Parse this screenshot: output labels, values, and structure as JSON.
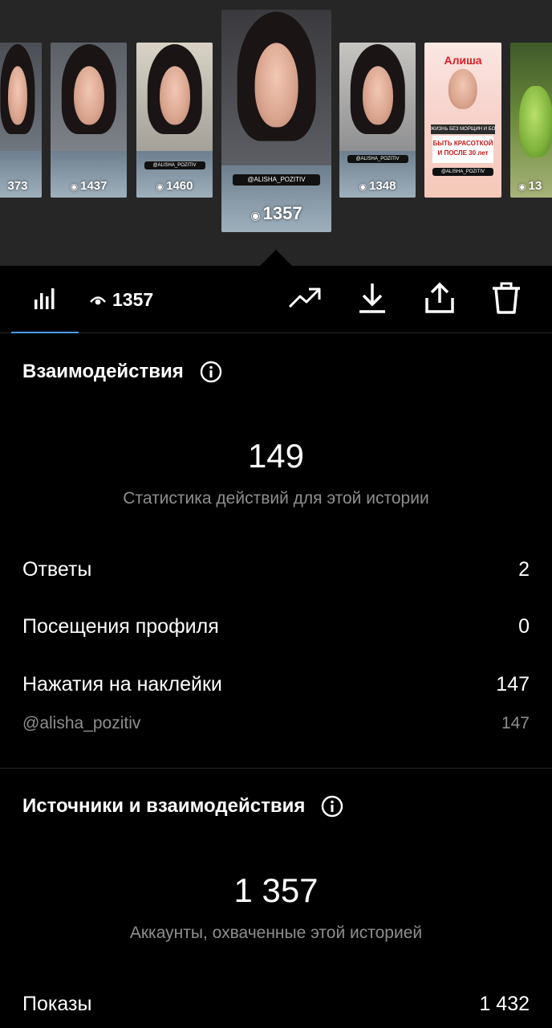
{
  "carousel": {
    "thumbs": [
      {
        "count": "373",
        "tag": "",
        "kind": "photo"
      },
      {
        "count": "1437",
        "tag": "",
        "kind": "photo"
      },
      {
        "count": "1460",
        "tag": "@ALISHA_POZITIV",
        "kind": "photo"
      },
      {
        "count": "1357",
        "tag": "@ALISHA_POZITIV",
        "kind": "photo",
        "selected": true
      },
      {
        "count": "1348",
        "tag": "@ALISHA_POZITIV",
        "kind": "photo"
      },
      {
        "count": "",
        "tag": "@ALISHA_POZITIV",
        "kind": "promo",
        "promo_title": "Алиша",
        "promo_strip": "ЖИЗНЬ БЕЗ МОРЩИН И БОТОКСА",
        "promo_box": "БЫТЬ КРАСОТКОЙ И ПОСЛЕ 30 лет"
      },
      {
        "count": "13",
        "tag": "",
        "kind": "dragon"
      }
    ]
  },
  "toolbar": {
    "views_count": "1357",
    "icons": [
      "bar-chart-icon",
      "eye-icon",
      "trending-icon",
      "download-icon",
      "share-icon",
      "trash-icon"
    ]
  },
  "interactions": {
    "title": "Взаимодействия",
    "total": "149",
    "caption": "Статистика действий для этой истории",
    "rows": [
      {
        "label": "Ответы",
        "value": "2"
      },
      {
        "label": "Посещения профиля",
        "value": "0"
      },
      {
        "label": "Нажатия на наклейки",
        "value": "147"
      }
    ],
    "sub_row": {
      "label": "@alisha_pozitiv",
      "value": "147"
    }
  },
  "discovery": {
    "title": "Источники и взаимодействия",
    "total": "1 357",
    "caption": "Аккаунты, охваченные этой историей",
    "rows": [
      {
        "label": "Показы",
        "value": "1 432"
      }
    ]
  },
  "colors": {
    "background": "#000000",
    "carousel_bg": "#262626",
    "accent": "#4a9eff",
    "muted_text": "#8e8e8e"
  }
}
